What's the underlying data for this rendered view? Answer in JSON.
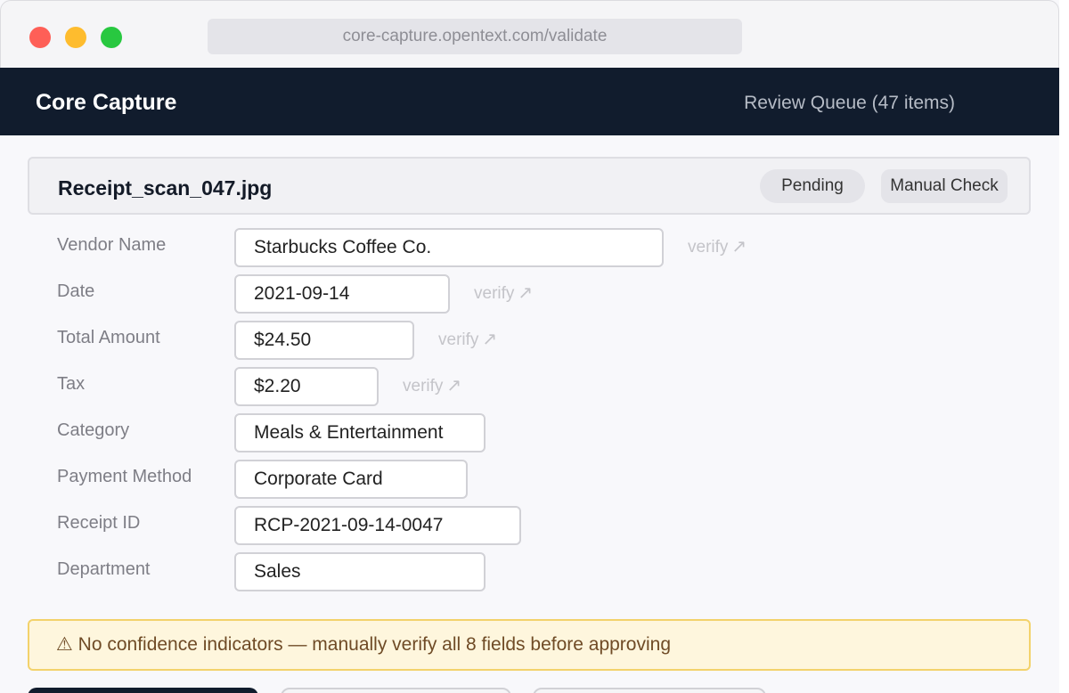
{
  "browser": {
    "url": "core-capture.opentext.com/validate"
  },
  "app": {
    "brand": "Core Capture",
    "queue_link": "Review Queue (47 items)"
  },
  "document": {
    "title": "Receipt_scan_047.jpg",
    "status_badge": "Pending",
    "review_badge": "Manual Check"
  },
  "verify_label": "verify",
  "verify_icon": "external-arrow-icon",
  "fields": [
    {
      "label": "Vendor Name",
      "value": "Starbucks Coffee Co.",
      "has_verify": true
    },
    {
      "label": "Date",
      "value": "2021-09-14",
      "has_verify": true
    },
    {
      "label": "Total Amount",
      "value": "$24.50",
      "has_verify": true
    },
    {
      "label": "Tax",
      "value": "$2.20",
      "has_verify": true
    },
    {
      "label": "Category",
      "value": "Meals & Entertainment",
      "has_verify": false
    },
    {
      "label": "Payment Method",
      "value": "Corporate Card",
      "has_verify": false
    },
    {
      "label": "Receipt ID",
      "value": "RCP-2021-09-14-0047",
      "has_verify": false
    },
    {
      "label": "Department",
      "value": "Sales",
      "has_verify": false
    }
  ],
  "warning": {
    "icon": "warning-icon",
    "text": "⚠ No confidence indicators — manually verify all 8 fields before approving"
  },
  "colors": {
    "header_bg": "#111c2d",
    "warning_bg": "#fef6dd",
    "warning_border": "#f3d26b",
    "traffic_red": "#fe5f57",
    "traffic_yellow": "#febc2e",
    "traffic_green": "#28c840"
  }
}
